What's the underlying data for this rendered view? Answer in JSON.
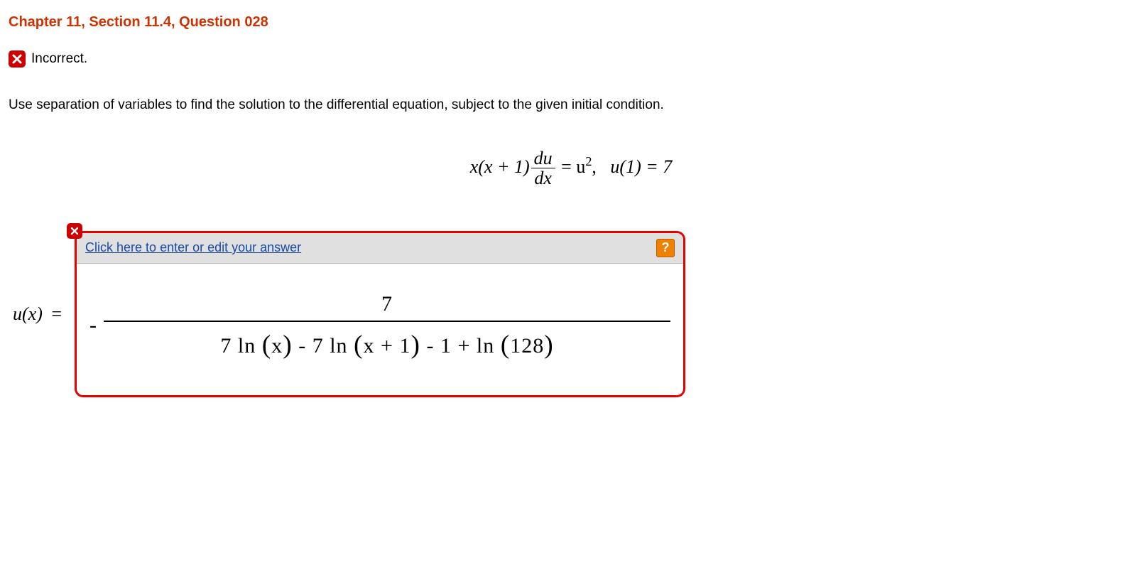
{
  "title": "Chapter 11, Section 11.4, Question 028",
  "status": {
    "label": "Incorrect."
  },
  "prompt": "Use separation of variables to find the solution to the differential equation, subject to the given initial condition.",
  "equation": {
    "lhs_pre": "x(x + 1)",
    "frac_num": "du",
    "frac_den": "dx",
    "rhs_eq": " = u",
    "rhs_exp": "2",
    "comma": ",",
    "ic": "u(1) = 7"
  },
  "answer": {
    "ux_label": "u(x)",
    "eq": " =",
    "edit_link": "Click here to enter or edit your answer",
    "help_symbol": "?",
    "neg": "-",
    "numerator": "7",
    "denominator": "7 ln (x) -  7 ln (x + 1) -  1 + ln (128)"
  }
}
